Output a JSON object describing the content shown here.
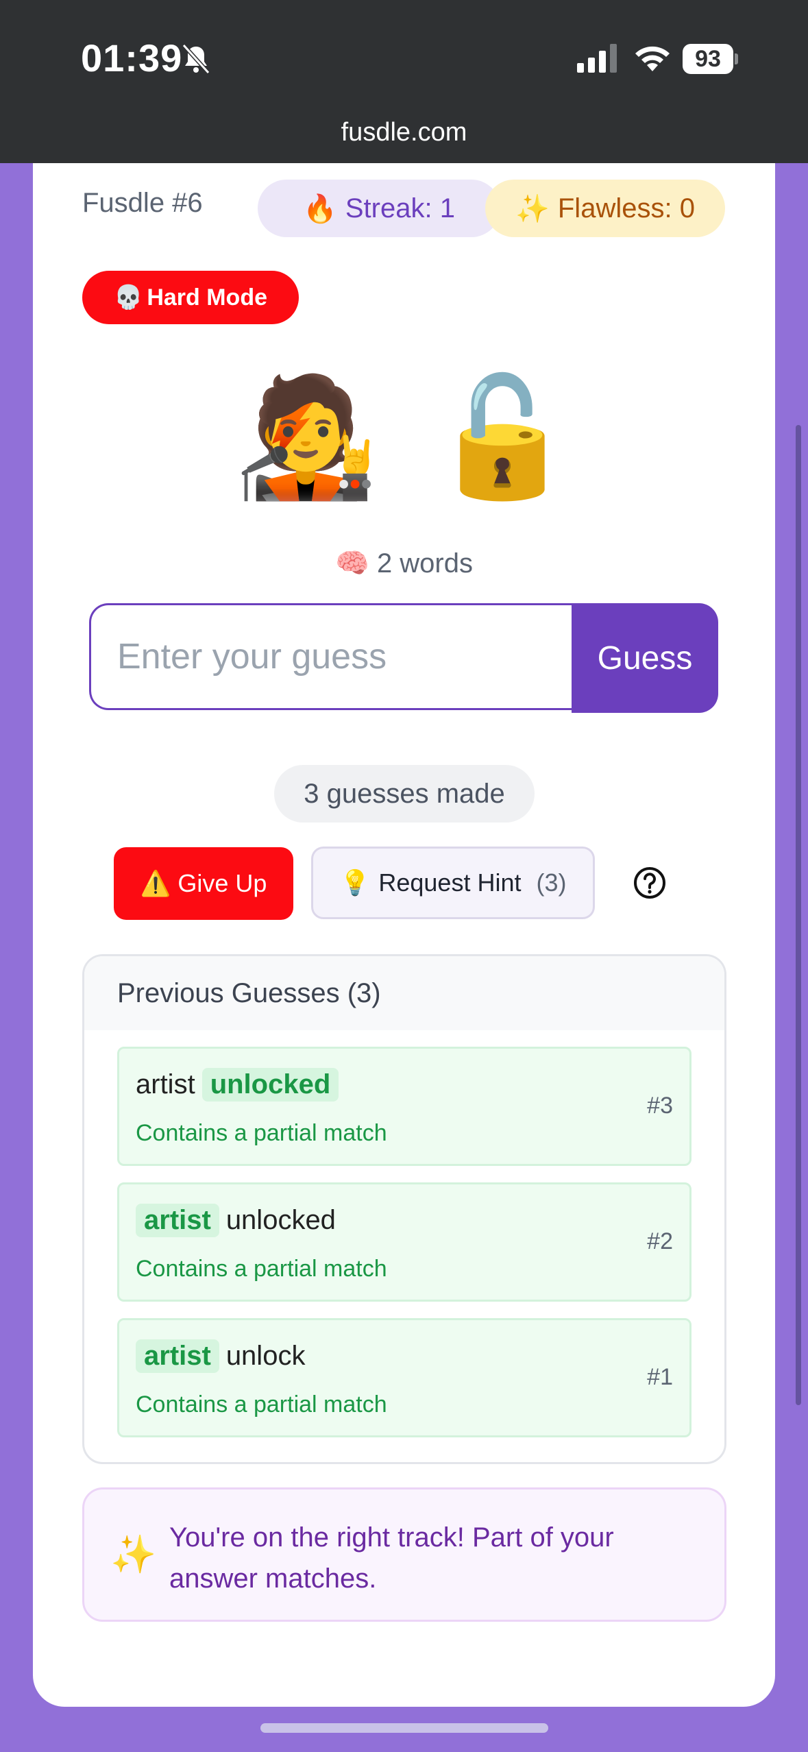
{
  "status_bar": {
    "time": "01:39",
    "battery": "93",
    "url": "fusdle.com"
  },
  "game": {
    "number_label": "Fusdle #6",
    "streak": {
      "icon": "🔥",
      "label": "Streak: 1"
    },
    "flawless": {
      "icon": "✨",
      "label": "Flawless: 0"
    },
    "hard_mode": {
      "icon": "💀",
      "label": "Hard Mode"
    },
    "emojis": [
      "🧑‍🎤",
      "🔓"
    ],
    "word_count": {
      "icon": "🧠",
      "label": "2 words"
    }
  },
  "guess_form": {
    "placeholder": "Enter your guess",
    "button_label": "Guess"
  },
  "guesses_made": "3 guesses made",
  "actions": {
    "give_up": {
      "icon": "⚠️",
      "label": "Give Up"
    },
    "hint": {
      "icon": "💡",
      "label": "Request Hint",
      "count": "(3)"
    }
  },
  "previous_guesses": {
    "title": "Previous Guesses (3)",
    "items": [
      {
        "words": [
          {
            "text": "artist",
            "highlight": false
          },
          {
            "text": "unlocked",
            "highlight": true
          }
        ],
        "status": "Contains a partial match",
        "num": "#3"
      },
      {
        "words": [
          {
            "text": "artist",
            "highlight": true
          },
          {
            "text": "unlocked",
            "highlight": false
          }
        ],
        "status": "Contains a partial match",
        "num": "#2"
      },
      {
        "words": [
          {
            "text": "artist",
            "highlight": true
          },
          {
            "text": "unlock",
            "highlight": false
          }
        ],
        "status": "Contains a partial match",
        "num": "#1"
      }
    ]
  },
  "tip": {
    "icon": "✨",
    "text": "You're on the right track! Part of your answer matches."
  },
  "colors": {
    "accent": "#6b3fbd",
    "danger": "#fc0b12",
    "success": "#1a9745",
    "background": "#9170d8"
  }
}
